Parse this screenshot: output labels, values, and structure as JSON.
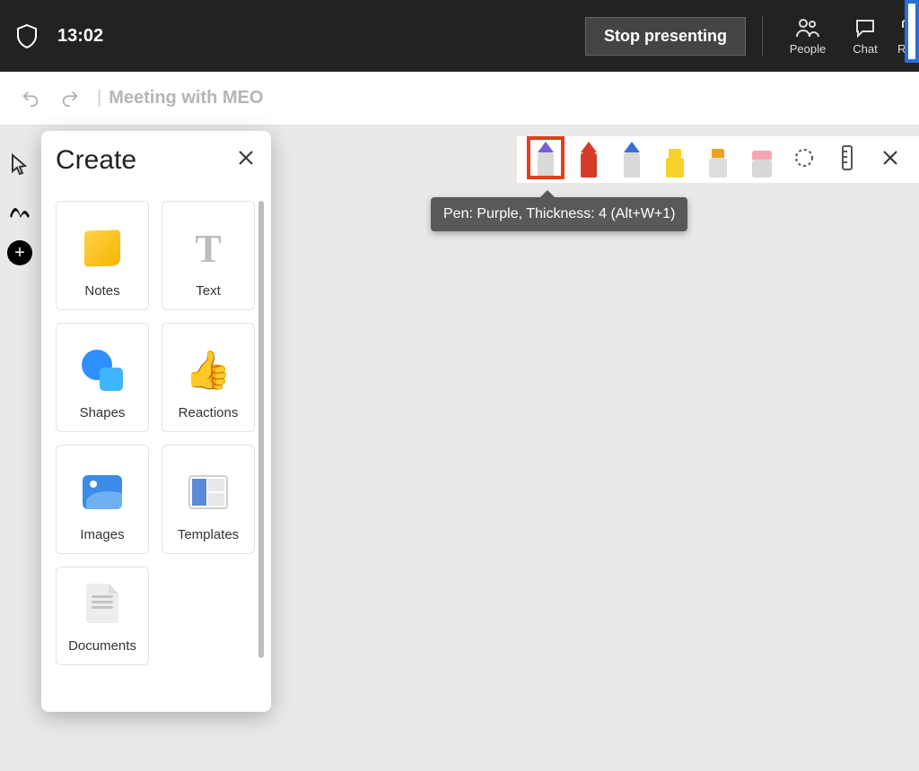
{
  "header": {
    "time": "13:02",
    "stop_label": "Stop presenting",
    "people_label": "People",
    "chat_label": "Chat",
    "r_label": "R"
  },
  "secondary": {
    "title": "Meeting with MEO"
  },
  "panel": {
    "title": "Create",
    "items": [
      {
        "label": "Notes"
      },
      {
        "label": "Text"
      },
      {
        "label": "Shapes"
      },
      {
        "label": "Reactions"
      },
      {
        "label": "Images"
      },
      {
        "label": "Templates"
      },
      {
        "label": "Documents"
      }
    ]
  },
  "tooltip": {
    "text": "Pen: Purple, Thickness: 4 (Alt+W+1)"
  },
  "pens": {
    "colors": {
      "purple": "#7b5bd6",
      "red": "#d63b2a",
      "blue": "#3a6fcf",
      "yellow": "#f6d22a",
      "orange": "#f0a020",
      "pink": "#f3a7b4"
    }
  }
}
